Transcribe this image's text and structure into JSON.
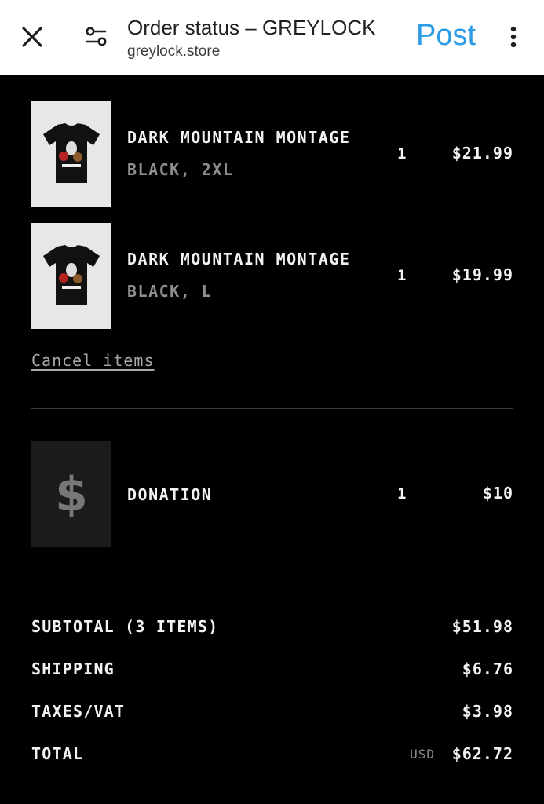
{
  "browser": {
    "title": "Order status – GREYLOCK",
    "url": "greylock.store",
    "post_label": "Post",
    "icons": [
      "close-icon",
      "tune-icon",
      "more-vertical-icon"
    ],
    "accent_color": "#2d9ce6"
  },
  "order": {
    "items": [
      {
        "name": "DARK MOUNTAIN MONTAGE",
        "variant": "BLACK, 2XL",
        "qty": "1",
        "price": "$21.99"
      },
      {
        "name": "DARK MOUNTAIN MONTAGE",
        "variant": "BLACK, L",
        "qty": "1",
        "price": "$19.99"
      }
    ],
    "cancel_label": "Cancel items",
    "donation": {
      "icon": "$",
      "name": "DONATION",
      "qty": "1",
      "price": "$10"
    }
  },
  "summary": {
    "subtotal_label": "SUBTOTAL (3 ITEMS)",
    "subtotal": "$51.98",
    "shipping_label": "SHIPPING",
    "shipping": "$6.76",
    "taxes_label": "TAXES/VAT",
    "taxes": "$3.98",
    "total_label": "TOTAL",
    "currency": "USD",
    "total": "$62.72"
  }
}
